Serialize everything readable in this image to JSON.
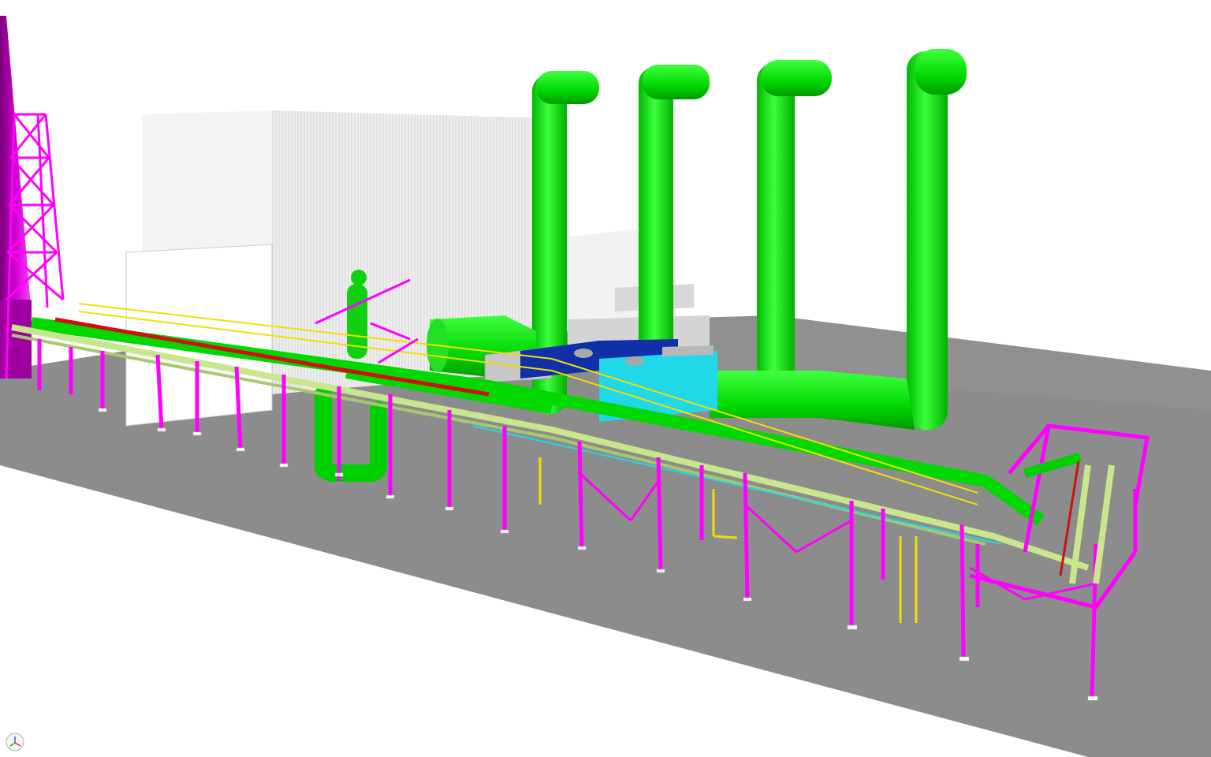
{
  "scene": {
    "name": "3d-plant-model-viewport",
    "colors": {
      "background": "#ffffff",
      "ground": "#8c8c8c",
      "ground_edge": "#9a9a9a",
      "structure": "#ff00ff",
      "duct": "#00e000",
      "duct_shade": "#00b800",
      "pipe_light": "#c8e68c",
      "pipe_red": "#d01010",
      "handrail": "#f0e000",
      "equipment_cyan": "#20d8e8",
      "equipment_blue": "#1030a8",
      "building": "#e6e6e6",
      "building_line": "#c8c8c8",
      "chimney": "#b000b0",
      "support_base": "#ffffff"
    }
  },
  "triad": {
    "icon": "view-orientation-triad-icon"
  }
}
